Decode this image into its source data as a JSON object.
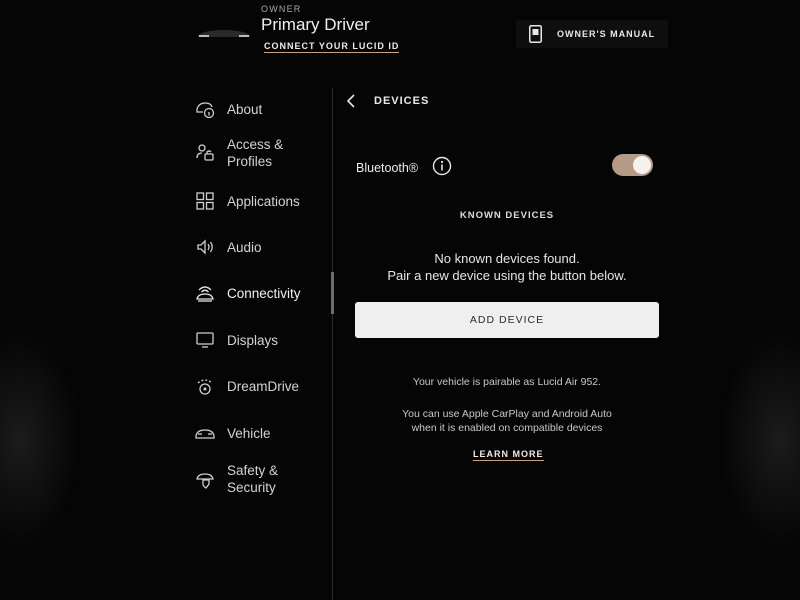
{
  "header": {
    "owner_label": "OWNER",
    "driver_name": "Primary Driver",
    "connect_link": "CONNECT YOUR LUCID ID",
    "manual_button": "OWNER'S MANUAL",
    "manual_icon": "book-icon",
    "car_icon": "car-silhouette-icon"
  },
  "sidebar": {
    "items": [
      {
        "label": "About",
        "icon": "car-info-icon"
      },
      {
        "label": "Access &\nProfiles",
        "icon": "profiles-icon"
      },
      {
        "label": "Applications",
        "icon": "grid-icon"
      },
      {
        "label": "Audio",
        "icon": "speaker-icon"
      },
      {
        "label": "Connectivity",
        "icon": "wifi-car-icon",
        "active": true
      },
      {
        "label": "Displays",
        "icon": "display-icon"
      },
      {
        "label": "DreamDrive",
        "icon": "steering-icon"
      },
      {
        "label": "Vehicle",
        "icon": "car-icon"
      },
      {
        "label": "Safety &\nSecurity",
        "icon": "shield-car-icon"
      }
    ]
  },
  "content": {
    "title": "DEVICES",
    "bluetooth_label": "Bluetooth®",
    "bluetooth_enabled": true,
    "known_devices_title": "KNOWN DEVICES",
    "empty_line_1": "No known devices found.",
    "empty_line_2": "Pair a new device using the button below.",
    "add_device_button": "ADD DEVICE",
    "pairable_note": "Your vehicle is pairable as Lucid Air 952.",
    "carplay_note_1": "You can use Apple CarPlay and Android Auto",
    "carplay_note_2": "when it is enabled on compatible devices",
    "learn_more": "LEARN MORE"
  },
  "colors": {
    "background": "#050505",
    "accent_underline": "#c9a27a",
    "toggle_on": "#b59a88",
    "button_bg": "#efefef"
  }
}
